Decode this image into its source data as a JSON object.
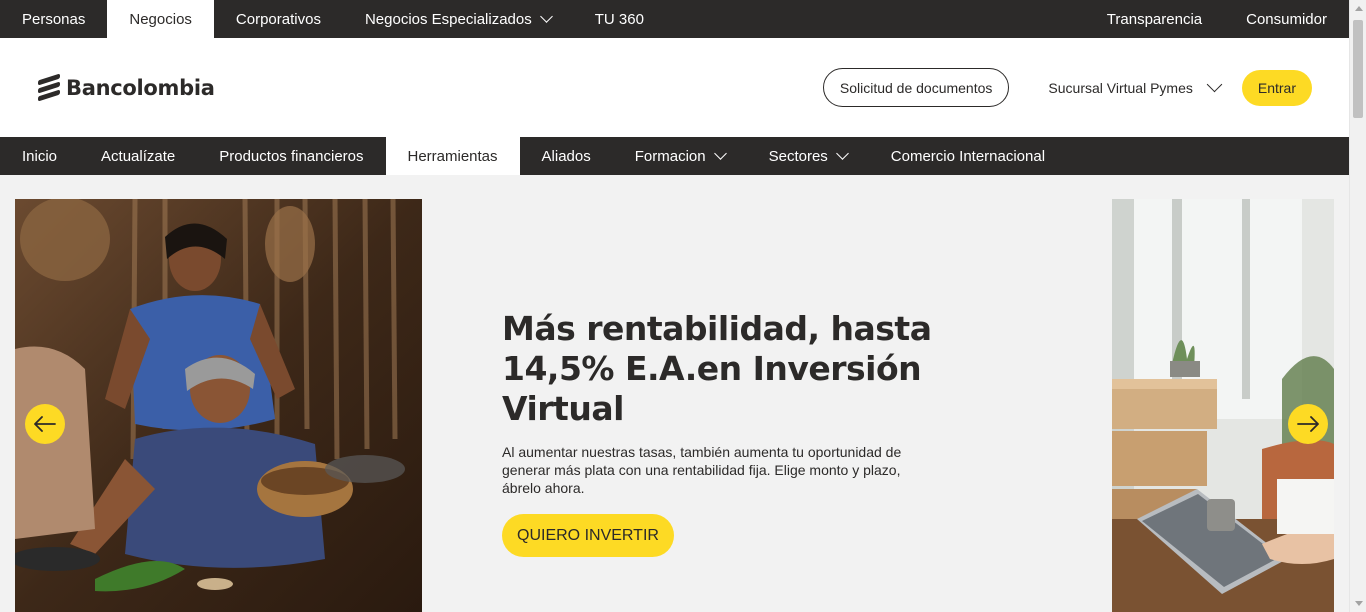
{
  "topbar": {
    "left": [
      "Personas",
      "Negocios",
      "Corporativos",
      "Negocios Especializados",
      "TU 360"
    ],
    "right": [
      "Transparencia",
      "Consumidor"
    ],
    "active": "Negocios"
  },
  "header": {
    "logo_text": "Bancolombia",
    "documents_button": "Solicitud de documentos",
    "branch_selector": "Sucursal Virtual Pymes",
    "login_button": "Entrar"
  },
  "subnav": {
    "items": [
      "Inicio",
      "Actualízate",
      "Productos financieros",
      "Herramientas",
      "Aliados",
      "Formacion",
      "Sectores",
      "Comercio Internacional"
    ],
    "active": "Herramientas"
  },
  "hero": {
    "title": "Más rentabilidad, hasta 14,5% E.A.en Inversión Virtual",
    "description": "Al aumentar nuestras tasas, también aumenta tu oportunidad de generar más plata con una rentabilidad fija. Elige monto y plazo, ábrelo ahora.",
    "cta": "QUIERO INVERTIR"
  },
  "colors": {
    "brand_dark": "#2c2a29",
    "brand_yellow": "#fdda24",
    "background": "#f2f2f2"
  },
  "icons": {
    "prev": "arrow-left-icon",
    "next": "arrow-right-icon",
    "dropdown": "chevron-down-icon"
  }
}
